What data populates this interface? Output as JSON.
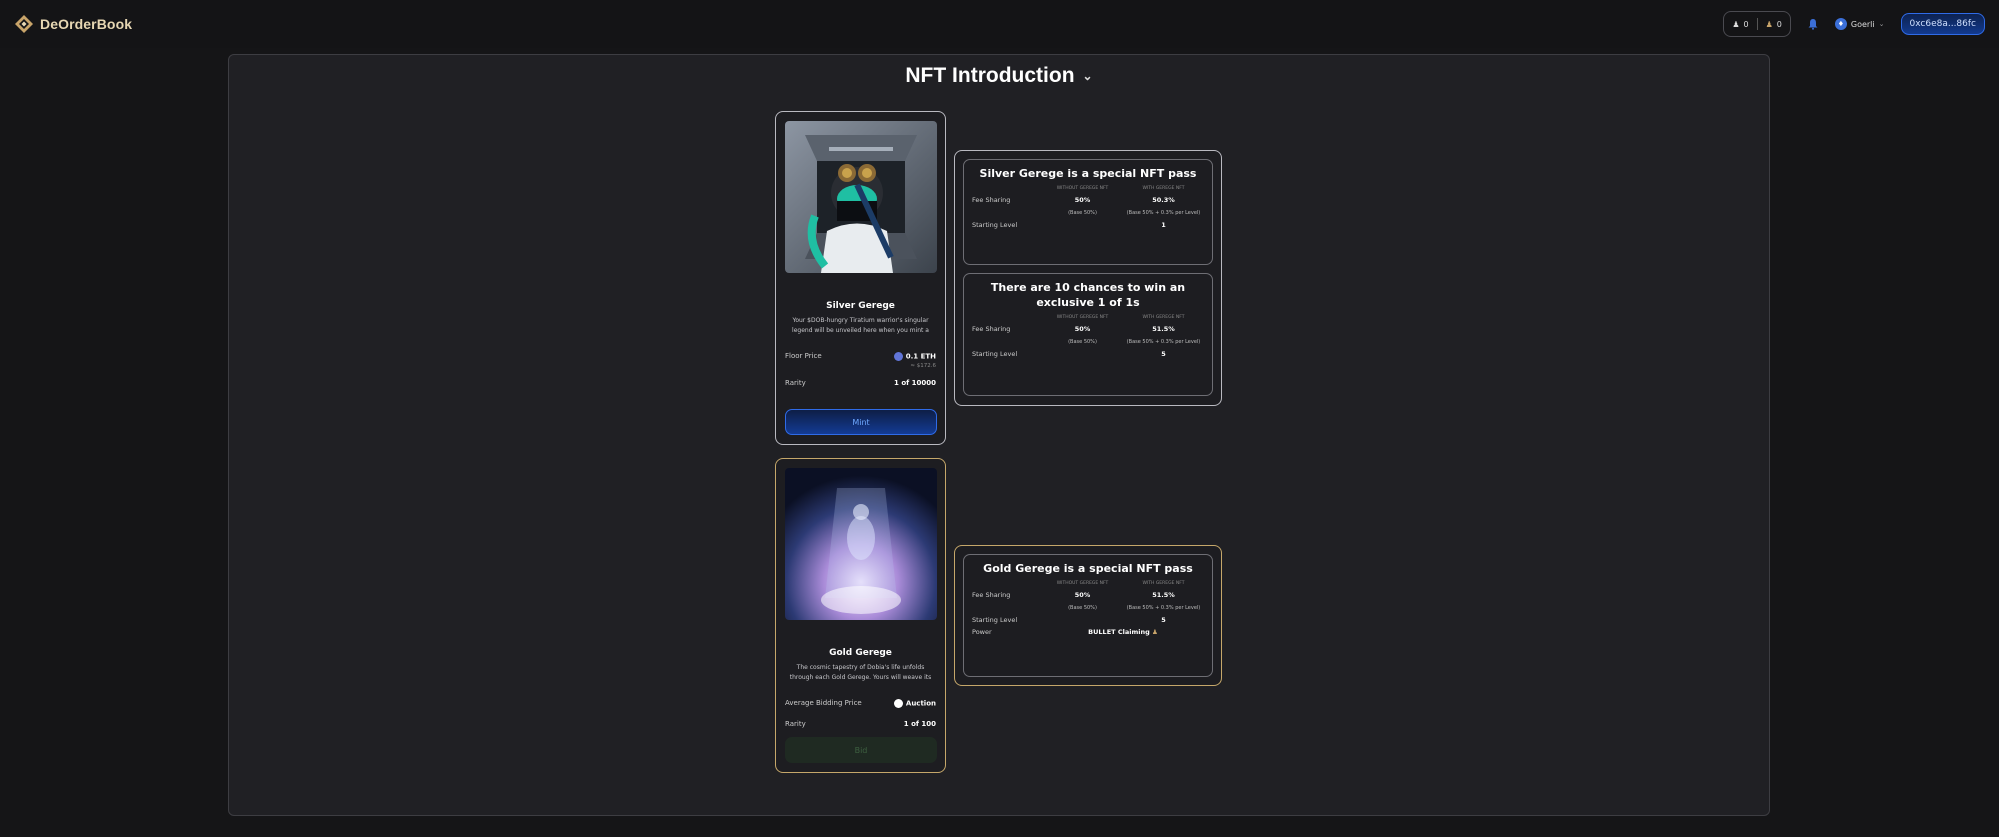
{
  "header": {
    "logo_text": "DeOrderBook",
    "counter_a": "0",
    "counter_b": "0",
    "network": "Goerli",
    "wallet": "0xc6e8a...86fc"
  },
  "title": "NFT Introduction",
  "silver_card": {
    "name": "Silver Gerege",
    "description": "Your $DOB-hungry Tiratium warrior's singular legend will be unveiled here when you mint a Silve...",
    "floor_label": "Floor Price",
    "floor_value": "0.1 ETH",
    "floor_sub": "≈ $172.6",
    "rarity_label": "Rarity",
    "rarity_value": "1 of 10000",
    "button": "Mint"
  },
  "gold_card": {
    "name": "Gold Gerege",
    "description": "The cosmic tapestry of Dobia's life unfolds through each Gold Gerege. Yours will weave its way here.",
    "avg_label": "Average Bidding Price",
    "avg_value": "Auction",
    "rarity_label": "Rarity",
    "rarity_value": "1 of 100",
    "button": "Bid"
  },
  "table_headers": {
    "without": "WITHOUT GEREGE NFT",
    "with": "WITH GEREGE NFT"
  },
  "silver_info": {
    "title": "Silver Gerege is a special NFT pass",
    "fee_label": "Fee Sharing",
    "fee_without": "50%",
    "fee_with": "50.3%",
    "note_without": "(Base 50%)",
    "note_with": "(Base 50% + 0.3% per Level)",
    "level_label": "Starting Level",
    "level_value": "1"
  },
  "chance_info": {
    "title": "There are 10 chances to win an exclusive 1 of 1s",
    "fee_label": "Fee Sharing",
    "fee_without": "50%",
    "fee_with": "51.5%",
    "note_without": "(Base 50%)",
    "note_with": "(Base 50% + 0.3% per Level)",
    "level_label": "Starting Level",
    "level_value": "5"
  },
  "gold_info": {
    "title": "Gold Gerege is a special NFT pass",
    "fee_label": "Fee Sharing",
    "fee_without": "50%",
    "fee_with": "51.5%",
    "note_without": "(Base 50%)",
    "note_with": "(Base 50% + 0.3% per Level)",
    "level_label": "Starting Level",
    "level_value": "5",
    "power_label": "Power",
    "power_value": "BULLET Claiming"
  }
}
